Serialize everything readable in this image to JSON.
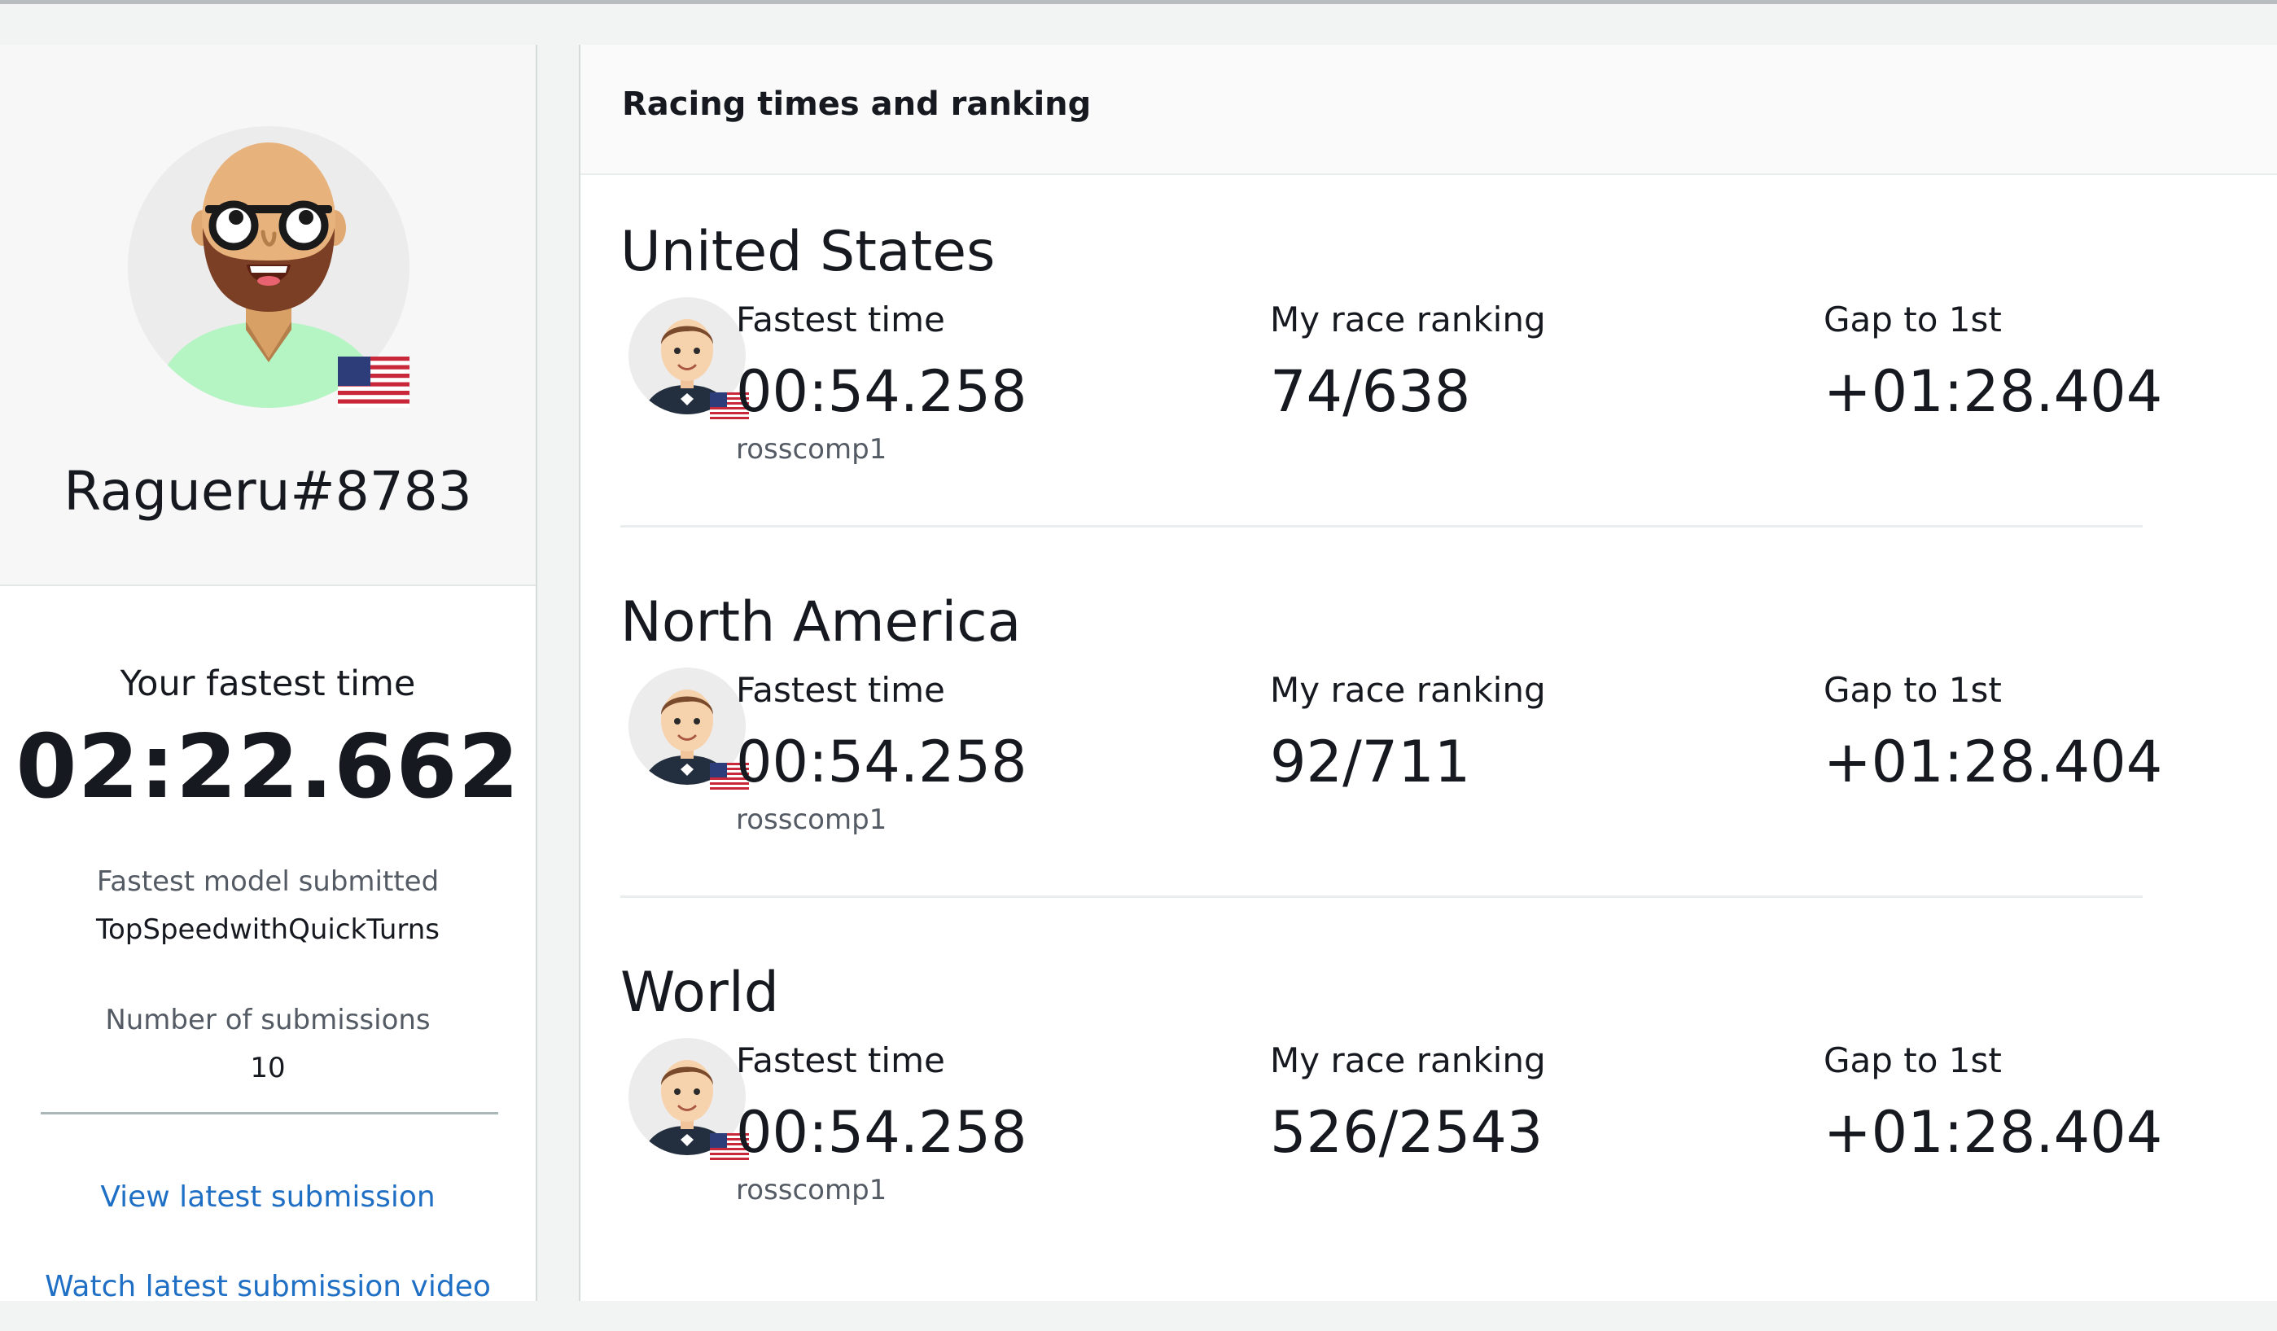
{
  "profile": {
    "username": "Ragueru#8783",
    "fastest_label": "Your fastest time",
    "fastest_time": "02:22.662",
    "model_label": "Fastest model submitted",
    "model_name": "TopSpeedwithQuickTurns",
    "submissions_label": "Number of submissions",
    "submissions_count": "10",
    "links": {
      "view_latest": "View latest submission",
      "watch_video": "Watch latest submission video"
    },
    "flag": "us-flag-icon"
  },
  "rankings": {
    "title": "Racing times and ranking",
    "regions": [
      {
        "name": "United States",
        "fastest_label": "Fastest time",
        "fastest_time": "00:54.258",
        "racer": "rosscomp1",
        "ranking_label": "My race ranking",
        "ranking": "74/638",
        "gap_label": "Gap to 1st",
        "gap": "+01:28.404"
      },
      {
        "name": "North America",
        "fastest_label": "Fastest time",
        "fastest_time": "00:54.258",
        "racer": "rosscomp1",
        "ranking_label": "My race ranking",
        "ranking": "92/711",
        "gap_label": "Gap to 1st",
        "gap": "+01:28.404"
      },
      {
        "name": "World",
        "fastest_label": "Fastest time",
        "fastest_time": "00:54.258",
        "racer": "rosscomp1",
        "ranking_label": "My race ranking",
        "ranking": "526/2543",
        "gap_label": "Gap to 1st",
        "gap": "+01:28.404"
      }
    ]
  },
  "colors": {
    "link": "#1f6fc5",
    "text": "#16191f",
    "muted": "#545b64",
    "avatar_shirt": "#b5f5c3"
  }
}
